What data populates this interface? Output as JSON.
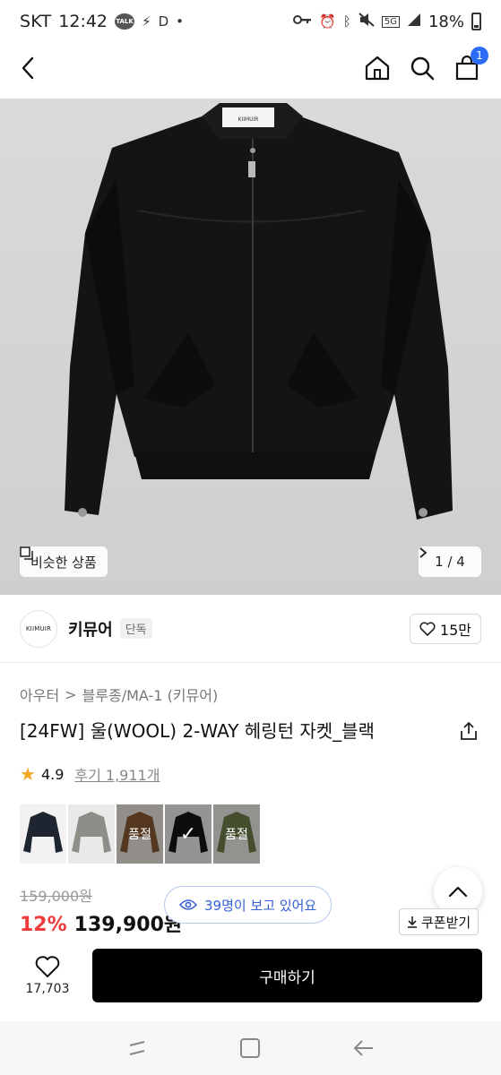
{
  "status_bar": {
    "carrier": "SKT",
    "time": "12:42",
    "talk_label": "TALK",
    "extra_indicator": "D",
    "dot": "•",
    "network": "5G",
    "battery": "18%"
  },
  "header": {
    "cart_count": "1"
  },
  "gallery": {
    "similar_label": "비슷한 상품",
    "page_indicator": "1 / 4",
    "brand_tag": "KIIMUIR"
  },
  "brand": {
    "logo_text": "KIIMUIR",
    "name": "키뮤어",
    "badge": "단독",
    "likes": "15만"
  },
  "breadcrumb": {
    "category": "아우터",
    "separator": ">",
    "subcategory": "블루종/MA-1 (키뮤어)"
  },
  "product": {
    "title": "[24FW] 울(WOOL) 2-WAY 헤링턴 자켓_블랙",
    "rating": "4.9",
    "reviews": "후기 1,911개",
    "original_price": "159,000원",
    "discount": "12%",
    "price": "139,900원"
  },
  "options": [
    {
      "color": "#1f2530",
      "label": ""
    },
    {
      "color": "#8e8e88",
      "label": ""
    },
    {
      "color": "#8a5a33",
      "label": "품절"
    },
    {
      "color": "#151515",
      "label": "✓"
    },
    {
      "color": "#6f7d4b",
      "label": "품절"
    }
  ],
  "viewers": "39명이 보고 있어요",
  "coupon": "쿠폰받기",
  "bottom": {
    "wish_count": "17,703",
    "buy_label": "구매하기"
  }
}
